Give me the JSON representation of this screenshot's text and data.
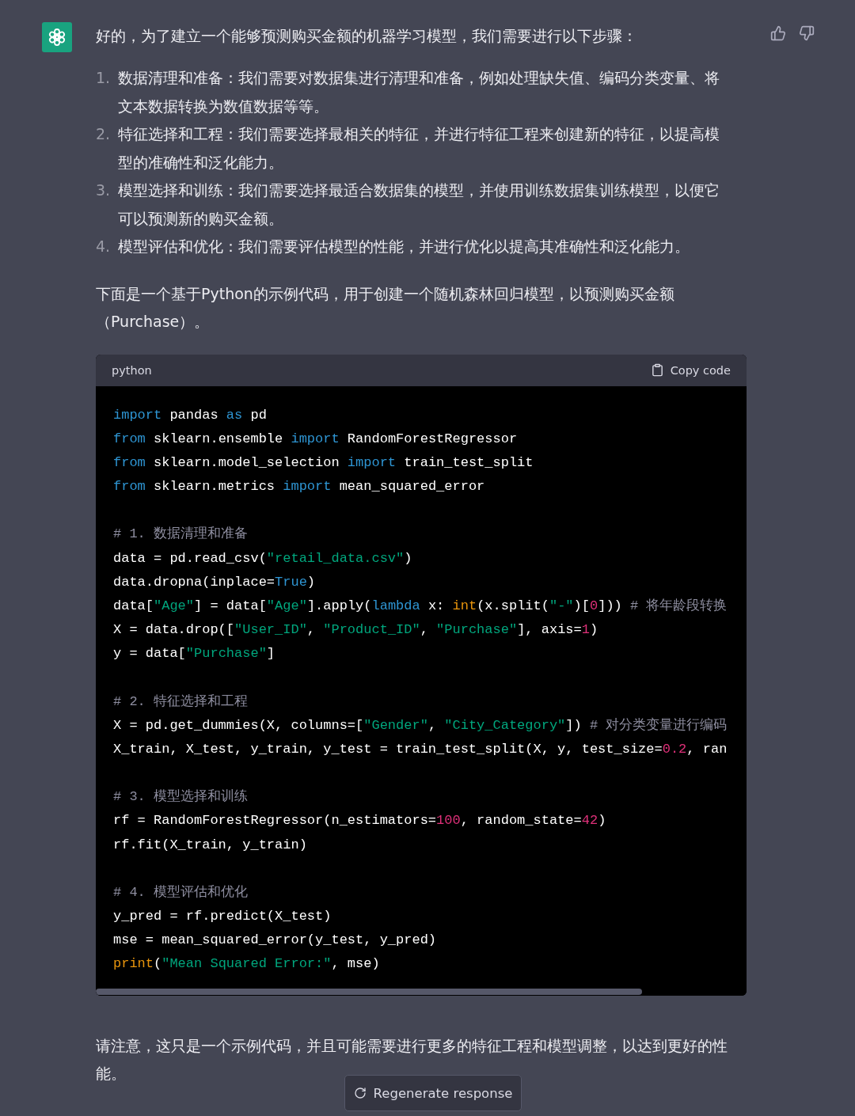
{
  "message": {
    "intro": "好的，为了建立一个能够预测购买金额的机器学习模型，我们需要进行以下步骤：",
    "steps": [
      {
        "number": "1.",
        "text": "数据清理和准备：我们需要对数据集进行清理和准备，例如处理缺失值、编码分类变量、将文本数据转换为数值数据等等。"
      },
      {
        "number": "2.",
        "text": "特征选择和工程：我们需要选择最相关的特征，并进行特征工程来创建新的特征，以提高模型的准确性和泛化能力。"
      },
      {
        "number": "3.",
        "text": "模型选择和训练：我们需要选择最适合数据集的模型，并使用训练数据集训练模型，以便它可以预测新的购买金额。"
      },
      {
        "number": "4.",
        "text": "模型评估和优化：我们需要评估模型的性能，并进行优化以提高其准确性和泛化能力。"
      }
    ],
    "lead": "下面是一个基于Python的示例代码，用于创建一个随机森林回归模型，以预测购买金额（Purchase）。",
    "code": {
      "language": "python",
      "copy_label": "Copy code",
      "blocks": [
        [
          [
            {
              "kind": "kw",
              "t": "import"
            },
            {
              "kind": "plain",
              "t": " pandas "
            },
            {
              "kind": "kw",
              "t": "as"
            },
            {
              "kind": "plain",
              "t": " pd"
            }
          ],
          [
            {
              "kind": "kw",
              "t": "from"
            },
            {
              "kind": "plain",
              "t": " sklearn.ensemble "
            },
            {
              "kind": "kw",
              "t": "import"
            },
            {
              "kind": "plain",
              "t": " RandomForestRegressor"
            }
          ],
          [
            {
              "kind": "kw",
              "t": "from"
            },
            {
              "kind": "plain",
              "t": " sklearn.model_selection "
            },
            {
              "kind": "kw",
              "t": "import"
            },
            {
              "kind": "plain",
              "t": " train_test_split"
            }
          ],
          [
            {
              "kind": "kw",
              "t": "from"
            },
            {
              "kind": "plain",
              "t": " sklearn.metrics "
            },
            {
              "kind": "kw",
              "t": "import"
            },
            {
              "kind": "plain",
              "t": " mean_squared_error"
            }
          ]
        ],
        [
          [
            {
              "kind": "comment",
              "t": "# 1. 数据清理和准备"
            }
          ],
          [
            {
              "kind": "plain",
              "t": "data = pd.read_csv("
            },
            {
              "kind": "str",
              "t": "\"retail_data.csv\""
            },
            {
              "kind": "plain",
              "t": ")"
            }
          ],
          [
            {
              "kind": "plain",
              "t": "data.dropna(inplace="
            },
            {
              "kind": "kw",
              "t": "True"
            },
            {
              "kind": "plain",
              "t": ")"
            }
          ],
          [
            {
              "kind": "plain",
              "t": "data["
            },
            {
              "kind": "str",
              "t": "\"Age\""
            },
            {
              "kind": "plain",
              "t": "] = data["
            },
            {
              "kind": "str",
              "t": "\"Age\""
            },
            {
              "kind": "plain",
              "t": "].apply("
            },
            {
              "kind": "kw",
              "t": "lambda"
            },
            {
              "kind": "plain",
              "t": " x: "
            },
            {
              "kind": "builtin",
              "t": "int"
            },
            {
              "kind": "plain",
              "t": "(x.split("
            },
            {
              "kind": "str",
              "t": "\"-\""
            },
            {
              "kind": "plain",
              "t": ")["
            },
            {
              "kind": "num",
              "t": "0"
            },
            {
              "kind": "plain",
              "t": "])) "
            },
            {
              "kind": "comment",
              "t": "# 将年龄段转换"
            }
          ],
          [
            {
              "kind": "plain",
              "t": "X = data.drop(["
            },
            {
              "kind": "str",
              "t": "\"User_ID\""
            },
            {
              "kind": "plain",
              "t": ", "
            },
            {
              "kind": "str",
              "t": "\"Product_ID\""
            },
            {
              "kind": "plain",
              "t": ", "
            },
            {
              "kind": "str",
              "t": "\"Purchase\""
            },
            {
              "kind": "plain",
              "t": "], axis="
            },
            {
              "kind": "num",
              "t": "1"
            },
            {
              "kind": "plain",
              "t": ")"
            }
          ],
          [
            {
              "kind": "plain",
              "t": "y = data["
            },
            {
              "kind": "str",
              "t": "\"Purchase\""
            },
            {
              "kind": "plain",
              "t": "]"
            }
          ]
        ],
        [
          [
            {
              "kind": "comment",
              "t": "# 2. 特征选择和工程"
            }
          ],
          [
            {
              "kind": "plain",
              "t": "X = pd.get_dummies(X, columns=["
            },
            {
              "kind": "str",
              "t": "\"Gender\""
            },
            {
              "kind": "plain",
              "t": ", "
            },
            {
              "kind": "str",
              "t": "\"City_Category\""
            },
            {
              "kind": "plain",
              "t": "]) "
            },
            {
              "kind": "comment",
              "t": "# 对分类变量进行编码"
            }
          ],
          [
            {
              "kind": "plain",
              "t": "X_train, X_test, y_train, y_test = train_test_split(X, y, test_size="
            },
            {
              "kind": "num",
              "t": "0.2"
            },
            {
              "kind": "plain",
              "t": ", ran"
            }
          ]
        ],
        [
          [
            {
              "kind": "comment",
              "t": "# 3. 模型选择和训练"
            }
          ],
          [
            {
              "kind": "plain",
              "t": "rf = RandomForestRegressor(n_estimators="
            },
            {
              "kind": "num",
              "t": "100"
            },
            {
              "kind": "plain",
              "t": ", random_state="
            },
            {
              "kind": "num",
              "t": "42"
            },
            {
              "kind": "plain",
              "t": ")"
            }
          ],
          [
            {
              "kind": "plain",
              "t": "rf.fit(X_train, y_train)"
            }
          ]
        ],
        [
          [
            {
              "kind": "comment",
              "t": "# 4. 模型评估和优化"
            }
          ],
          [
            {
              "kind": "plain",
              "t": "y_pred = rf.predict(X_test)"
            }
          ],
          [
            {
              "kind": "plain",
              "t": "mse = mean_squared_error(y_test, y_pred)"
            }
          ],
          [
            {
              "kind": "builtin",
              "t": "print"
            },
            {
              "kind": "plain",
              "t": "("
            },
            {
              "kind": "str",
              "t": "\"Mean Squared Error:\""
            },
            {
              "kind": "plain",
              "t": ", mse)"
            }
          ]
        ]
      ]
    },
    "note": "请注意，这只是一个示例代码，并且可能需要进行更多的特征工程和模型调整，以达到更好的性能。"
  },
  "regenerate_button": "Regenerate response"
}
